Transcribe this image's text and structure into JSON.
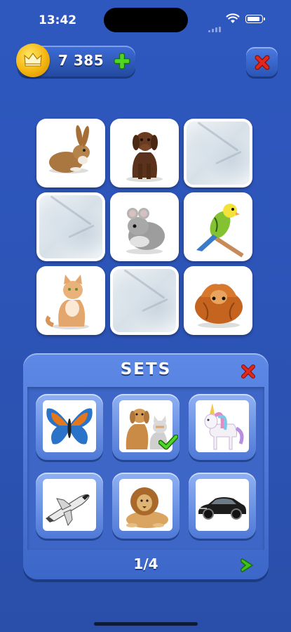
{
  "status_bar": {
    "time": "13:42"
  },
  "header": {
    "coin_balance": "7 385",
    "icons": {
      "coin": "crown-coin-icon",
      "add": "plus-icon",
      "close": "close-icon"
    }
  },
  "board": {
    "cards": [
      {
        "state": "revealed",
        "animal": "rabbit"
      },
      {
        "state": "revealed",
        "animal": "brown-dog"
      },
      {
        "state": "hidden"
      },
      {
        "state": "hidden"
      },
      {
        "state": "revealed",
        "animal": "chinchilla"
      },
      {
        "state": "revealed",
        "animal": "parakeet"
      },
      {
        "state": "revealed",
        "animal": "cat"
      },
      {
        "state": "hidden"
      },
      {
        "state": "revealed",
        "animal": "guinea-pig"
      }
    ]
  },
  "sets_panel": {
    "title": "SETS",
    "sets": [
      {
        "name": "butterfly",
        "selected": false
      },
      {
        "name": "dog-and-cat",
        "selected": true
      },
      {
        "name": "unicorn",
        "selected": false
      },
      {
        "name": "space-shuttle",
        "selected": false
      },
      {
        "name": "lion",
        "selected": false
      },
      {
        "name": "sports-car",
        "selected": false
      }
    ],
    "page": "1/4"
  },
  "colors": {
    "background": "#2d55b9",
    "accent_green": "#3fc21a",
    "close_red": "#e0281e",
    "coin_gold": "#f4b50f"
  }
}
